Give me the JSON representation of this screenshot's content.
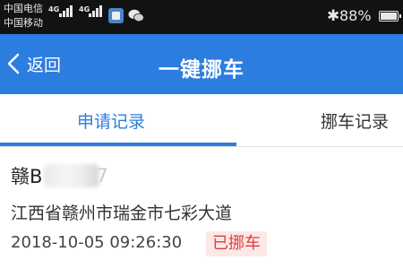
{
  "status_bar": {
    "carrier_1": "中国电信",
    "carrier_2": "中国移动",
    "network_1": "4G",
    "network_2": "4G",
    "battery": "88%",
    "icons": [
      "signal-icon",
      "signal-icon",
      "app-notification-icon",
      "wechat-icon",
      "bluetooth-icon",
      "battery-icon"
    ]
  },
  "header": {
    "back_label": "返回",
    "title": "一键挪车",
    "background_color": "#2c7de0"
  },
  "tabs": [
    {
      "label": "申请记录",
      "active": true
    },
    {
      "label": "挪车记录",
      "active": false
    }
  ],
  "record": {
    "plate_prefix": "赣B",
    "plate_tail": "7",
    "address": "江西省赣州市瑞金市七彩大道",
    "datetime": "2018-10-05 09:26:30",
    "status": "已挪车",
    "status_color": "#e03c3c"
  }
}
